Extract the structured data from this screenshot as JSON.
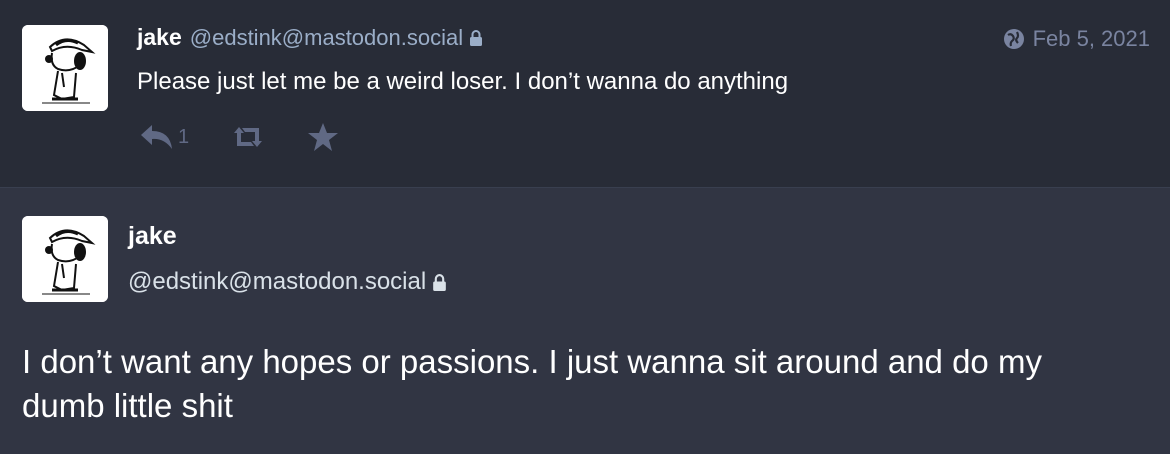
{
  "reply_status": {
    "display_name": "jake",
    "acct": "@edstink@mastodon.social",
    "date": "Feb 5, 2021",
    "content": "Please just let me be a weird loser. I don’t wanna do anything",
    "reply_count": "1",
    "visibility_icon": "lock-icon"
  },
  "detailed_status": {
    "display_name": "jake",
    "acct": "@edstink@mastodon.social",
    "content": "I don’t want any hopes or passions. I just wanna sit around and do my dumb little shit"
  },
  "colors": {
    "background_top": "#282c37",
    "background_bottom": "#313543",
    "muted": "#606984",
    "secondary": "#9baec8"
  }
}
